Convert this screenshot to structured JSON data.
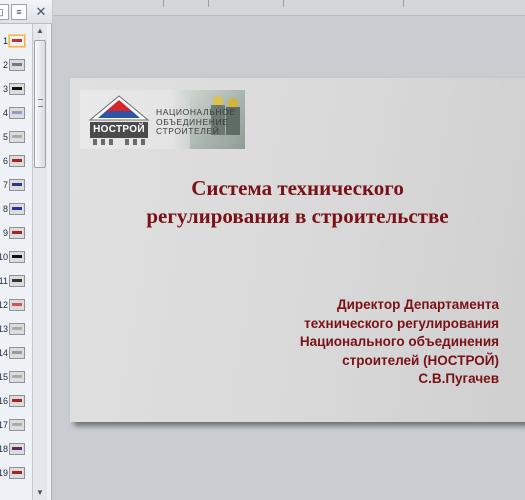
{
  "panel": {
    "slides_tab_label": "▯",
    "outline_tab_label": "≡",
    "close_label": "✕"
  },
  "scrollbar": {
    "up": "▲",
    "down": "▼"
  },
  "thumbnails": [
    {
      "num": "1",
      "color": "#b33"
    },
    {
      "num": "2",
      "color": "#777"
    },
    {
      "num": "3",
      "color": "#111"
    },
    {
      "num": "4",
      "color": "#8aa0c8"
    },
    {
      "num": "5",
      "color": "#aaa"
    },
    {
      "num": "6",
      "color": "#a22"
    },
    {
      "num": "7",
      "color": "#2a3a8a"
    },
    {
      "num": "8",
      "color": "#2233aa"
    },
    {
      "num": "9",
      "color": "#a22"
    },
    {
      "num": "10",
      "color": "#111"
    },
    {
      "num": "11",
      "color": "#333"
    },
    {
      "num": "12",
      "color": "#c55"
    },
    {
      "num": "13",
      "color": "#aaa"
    },
    {
      "num": "14",
      "color": "#999"
    },
    {
      "num": "15",
      "color": "#aaa"
    },
    {
      "num": "16",
      "color": "#a22"
    },
    {
      "num": "17",
      "color": "#aaa"
    },
    {
      "num": "18",
      "color": "#5a2a6a"
    },
    {
      "num": "19",
      "color": "#a22"
    }
  ],
  "slide": {
    "logo": {
      "name": "НОСТРОЙ",
      "tagline": [
        "НАЦИОНАЛЬНОЕ",
        "ОБЪЕДИНЕНИЕ",
        "СТРОИТЕЛЕЙ"
      ]
    },
    "title": [
      "Система технического",
      "регулирования в строительстве"
    ],
    "subtitle": [
      "Директор Департамента",
      "технического регулирования",
      "Национального объединения",
      "строителей (НОСТРОЙ)",
      "С.В.Пугачев"
    ],
    "accent_color": "#7a1116"
  }
}
